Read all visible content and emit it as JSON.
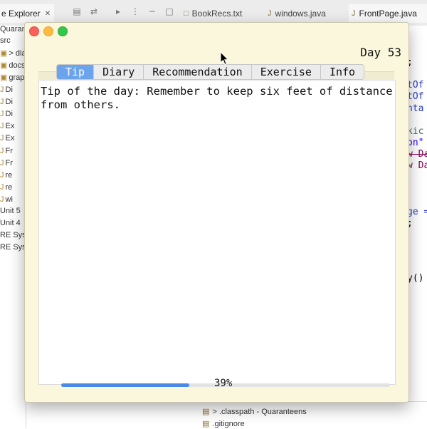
{
  "ide": {
    "explorer_tab": "e Explorer",
    "close_glyph": "✕",
    "editor_tabs": [
      {
        "label": "BookRecs.txt"
      },
      {
        "label": "windows.java"
      },
      {
        "label": "FrontPage.java"
      }
    ],
    "tree_items": [
      {
        "label": "Quarante"
      },
      {
        "label": "src"
      },
      {
        "label": "> diar"
      },
      {
        "label": "docs"
      },
      {
        "label": "graph"
      },
      {
        "label": "Di"
      },
      {
        "label": "Di"
      },
      {
        "label": "Di"
      },
      {
        "label": "Ex"
      },
      {
        "label": "Ex"
      },
      {
        "label": "Fr"
      },
      {
        "label": "Fr"
      },
      {
        "label": "re"
      },
      {
        "label": "re"
      },
      {
        "label": "wi"
      },
      {
        "label": "Unit 5"
      },
      {
        "label": "Unit 4"
      },
      {
        "label": "RE Sys"
      },
      {
        "label": "RE Sys"
      }
    ],
    "code_fragments": [
      {
        "text": ";",
        "color": "#111111"
      },
      {
        "text": "tOf",
        "color": "#2a3ec9"
      },
      {
        "text": "tOf",
        "color": "#2a3ec9"
      },
      {
        "text": "nta",
        "color": "#2a3ec9"
      },
      {
        "text": "kic",
        "color": "#3f7f5f"
      },
      {
        "text": "on\"",
        "color": "#2a00ff"
      },
      {
        "text": "w Da",
        "color": "#7f0055"
      },
      {
        "text": "w Da",
        "color": "#7f0055"
      },
      {
        "text": "ge =",
        "color": "#2a3ec9"
      },
      {
        "text": ";",
        "color": "#111111"
      },
      {
        "text": "y()",
        "color": "#111111"
      }
    ],
    "bottom_items": [
      {
        "label": "> .classpath - Quaranteens"
      },
      {
        "label": ".gitignore"
      }
    ]
  },
  "app": {
    "day_label": "Day 53",
    "tabs": [
      {
        "label": "Tip",
        "selected": true
      },
      {
        "label": "Diary",
        "selected": false
      },
      {
        "label": "Recommendation",
        "selected": false
      },
      {
        "label": "Exercise",
        "selected": false
      },
      {
        "label": "Info",
        "selected": false
      }
    ],
    "tip_text": "Tip of the day: Remember to keep six feet of distance from others.",
    "progress": {
      "percent": 39,
      "label": "39%"
    }
  },
  "colors": {
    "window_bg": "#fbf7dc",
    "tab_selected": "#6ba4ec",
    "progress_fill": "#4a8ae6"
  }
}
